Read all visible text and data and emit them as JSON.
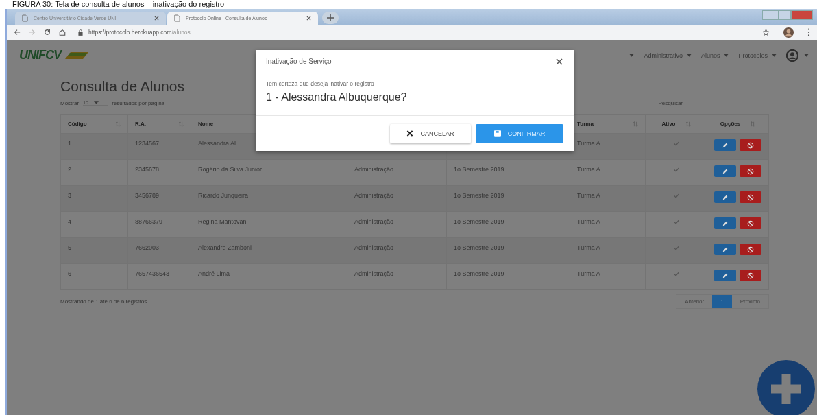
{
  "caption": "FIGURA 30: Tela de consulta de alunos – inativação do registro",
  "browser": {
    "tabs": [
      {
        "title": "Centro Universitário Cidade Verde UNI",
        "selected": false
      },
      {
        "title": "Protocolo Online - Consulta de Alunos",
        "selected": true
      }
    ],
    "url_host": "https://protocolo.herokuapp.com",
    "url_path": "/alunos"
  },
  "navbar": {
    "logo": "UNIFCV",
    "menus": [
      "Administrativo",
      "Alunos",
      "Protocolos"
    ]
  },
  "page": {
    "title": "Consulta de Alunos",
    "show_before": "Mostrar",
    "page_size": "10",
    "show_after": "resultados por página",
    "search_label": "Pesquisar"
  },
  "table": {
    "columns": [
      {
        "label": "Código"
      },
      {
        "label": "R.A."
      },
      {
        "label": "Nome"
      },
      {},
      {},
      {
        "label": "Turma"
      },
      {
        "label": "Ativo"
      },
      {
        "label": "Opções"
      }
    ],
    "rows": [
      {
        "codigo": "1",
        "ra": "1234567",
        "nome": "Alessandra Al",
        "turma": "Turma A",
        "ativo": true
      },
      {
        "codigo": "2",
        "ra": "2345678",
        "nome": "Rogério da Silva Junior",
        "column_4": "Administração",
        "column_5": "1o Semestre 2019",
        "turma": "Turma A",
        "ativo": true
      },
      {
        "codigo": "3",
        "ra": "3456789",
        "nome": "Ricardo Junqueira",
        "column_4": "Administração",
        "column_5": "1o Semestre 2019",
        "turma": "Turma A",
        "ativo": true
      },
      {
        "codigo": "4",
        "ra": "88766379",
        "nome": "Regina Mantovani",
        "column_4": "Administração",
        "column_5": "1o Semestre 2019",
        "turma": "Turma A",
        "ativo": true
      },
      {
        "codigo": "5",
        "ra": "7662003",
        "nome": "Alexandre Zamboni",
        "column_4": "Administração",
        "column_5": "1o Semestre 2019",
        "turma": "Turma A",
        "ativo": true
      },
      {
        "codigo": "6",
        "ra": "7657436543",
        "nome": "André Lima",
        "column_4": "Administração",
        "column_5": "1o Semestre 2019",
        "turma": "Turma A",
        "ativo": true
      }
    ]
  },
  "footer": {
    "info": "Mostrando de 1 até 6 de 6 registros",
    "pages": [
      {
        "label": "Anterior",
        "selected": false
      },
      {
        "label": "1",
        "selected": true
      },
      {
        "label": "Próximo",
        "selected": false
      }
    ]
  },
  "modal": {
    "title": "Inativação de Serviço",
    "message": "Tem certeza que deseja inativar o registro",
    "record": "1 - Alessandra Albuquerque?",
    "buttons": [
      {
        "label": "CANCELAR",
        "kind": "cancel"
      },
      {
        "label": "CONFIRMAR",
        "kind": "confirm"
      }
    ]
  }
}
